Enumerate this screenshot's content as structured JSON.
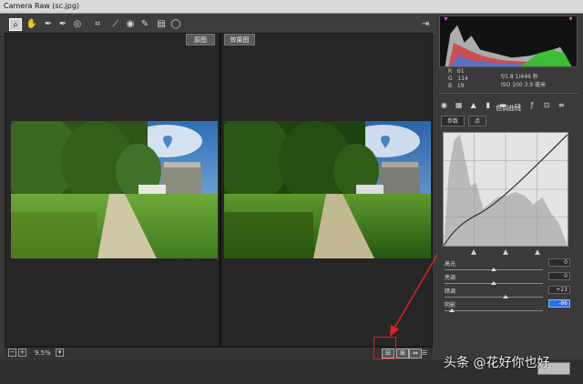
{
  "window": {
    "title": "Camera Raw (sc.jpg)"
  },
  "toolbar": {
    "tools": [
      {
        "icon": "zoom-icon",
        "glyph": "🔍"
      },
      {
        "icon": "hand-icon",
        "glyph": "✋"
      },
      {
        "icon": "white-balance-icon",
        "glyph": "✎"
      },
      {
        "icon": "color-sampler-icon",
        "glyph": "✎"
      },
      {
        "icon": "targeted-adjustment-icon",
        "glyph": "◎"
      },
      {
        "icon": "crop-icon",
        "glyph": "⌗"
      },
      {
        "icon": "straighten-icon",
        "glyph": "⟋"
      },
      {
        "icon": "red-eye-icon",
        "glyph": "◉"
      },
      {
        "icon": "adjustment-brush-icon",
        "glyph": "🖌"
      },
      {
        "icon": "graduated-filter-icon",
        "glyph": "▤"
      },
      {
        "icon": "radial-filter-icon",
        "glyph": "◯"
      }
    ],
    "open_icon": "export-icon"
  },
  "preview": {
    "before_label": "原图",
    "after_label": "效果图"
  },
  "statusbar": {
    "zoom": "9.5%",
    "view_buttons": [
      "⊟",
      "⊞",
      "⇔"
    ]
  },
  "histogram": {
    "r_label": "R",
    "r_value": "61",
    "g_label": "G",
    "g_value": "114",
    "b_label": "B",
    "b_value": "19",
    "exposure": "f/1.8  1/446 秒",
    "iso": "ISO 100  3.9 毫米"
  },
  "panel": {
    "title": "色调曲线",
    "tab_parametric": "参数",
    "tab_point": "点",
    "sliders": [
      {
        "label": "高光",
        "value": "0",
        "level": 0.5,
        "selected": false
      },
      {
        "label": "亮调",
        "value": "0",
        "level": 0.5,
        "selected": false
      },
      {
        "label": "暗调",
        "value": "+23",
        "level": 0.62,
        "selected": false
      },
      {
        "label": "阴影",
        "value": "-86",
        "level": 0.07,
        "selected": true
      }
    ]
  },
  "watermark": "头条 @花好你也好",
  "colors": {
    "accent_red": "#e02020",
    "select_blue": "#2f6fe0"
  }
}
